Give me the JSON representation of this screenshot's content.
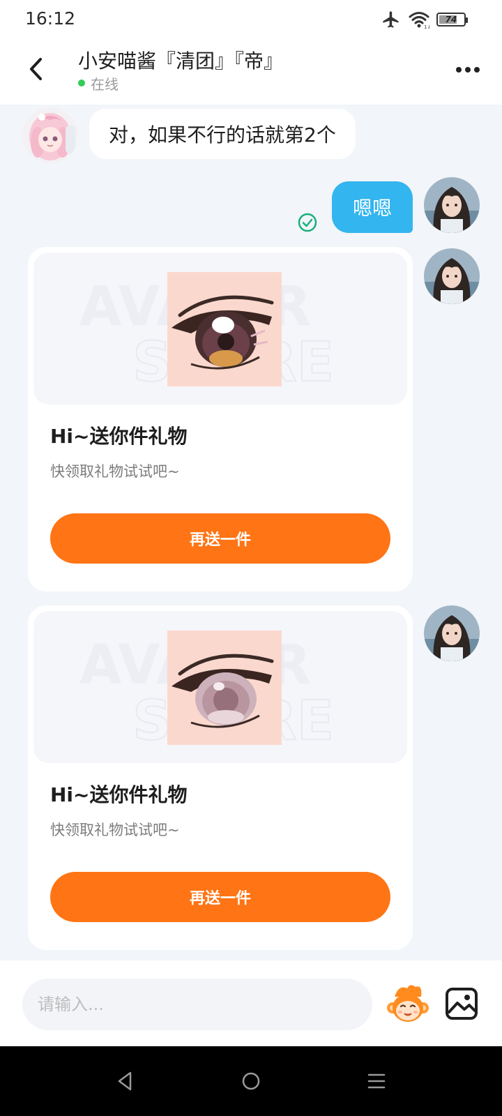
{
  "status_bar": {
    "time": "16:12",
    "battery_level": "74",
    "battery_percent": 74
  },
  "header": {
    "peer_name": "小安喵酱『清团』『帝』",
    "online_status": "在线"
  },
  "messages": [
    {
      "direction": "incoming",
      "text": "对，如果不行的话就第2个"
    },
    {
      "direction": "outgoing",
      "text": "嗯嗯",
      "read": true
    }
  ],
  "gift_cards": [
    {
      "title": "Hi~送你件礼物",
      "subtitle": "快领取礼物试试吧~",
      "button_label": "再送一件"
    },
    {
      "title": "Hi~送你件礼物",
      "subtitle": "快领取礼物试试吧~",
      "button_label": "再送一件"
    }
  ],
  "input": {
    "placeholder": "请输入..."
  },
  "icons": {
    "back": "chevron-left-icon",
    "more": "more-dots-icon",
    "read": "check-circle-icon",
    "emoji": "monkey-emoji-icon",
    "image": "image-icon",
    "airplane": "airplane-icon",
    "wifi": "wifi-icon",
    "battery": "battery-icon"
  },
  "colors": {
    "accent_blue": "#33b5ef",
    "accent_orange": "#ff7414",
    "online_green": "#33cc55",
    "read_green": "#17b07a",
    "chat_background": "#f2f5f9"
  }
}
